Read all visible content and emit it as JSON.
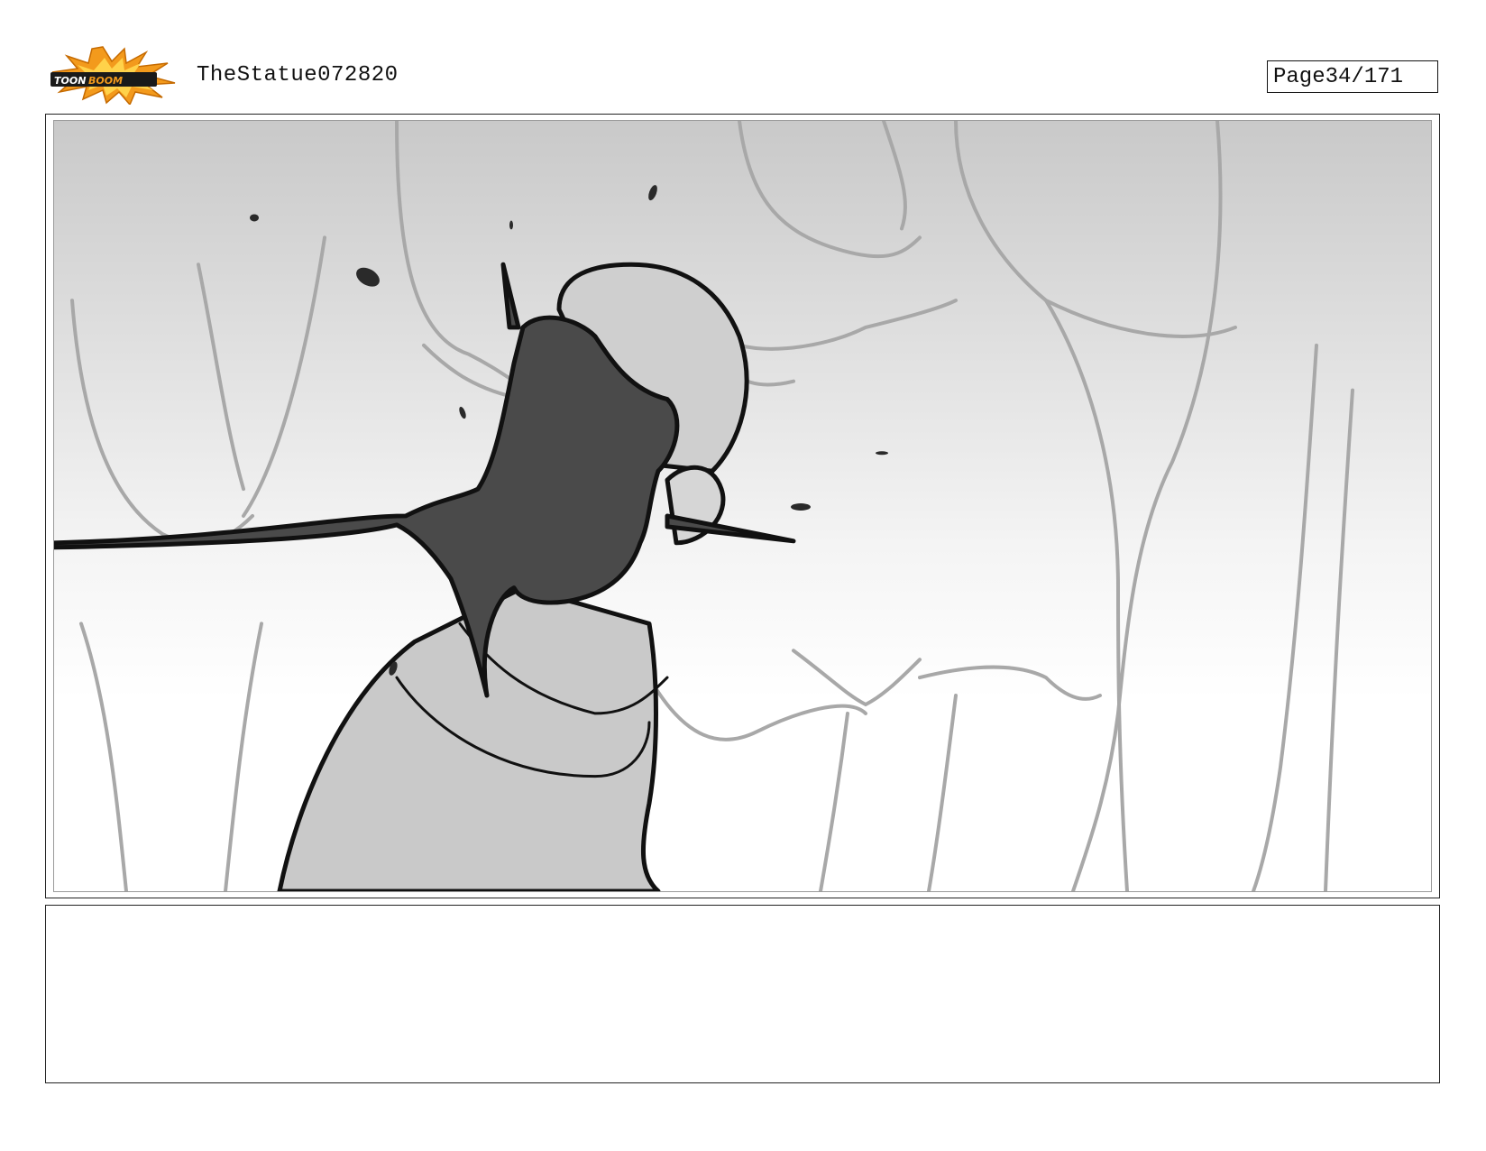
{
  "header": {
    "logo_text": "TOON BOOM",
    "title": "TheStatue072820",
    "page_label": "Page",
    "page_number": "34/171"
  },
  "panel": {
    "image_icon": "storyboard-sketch-icon"
  },
  "caption": {
    "text": ""
  }
}
